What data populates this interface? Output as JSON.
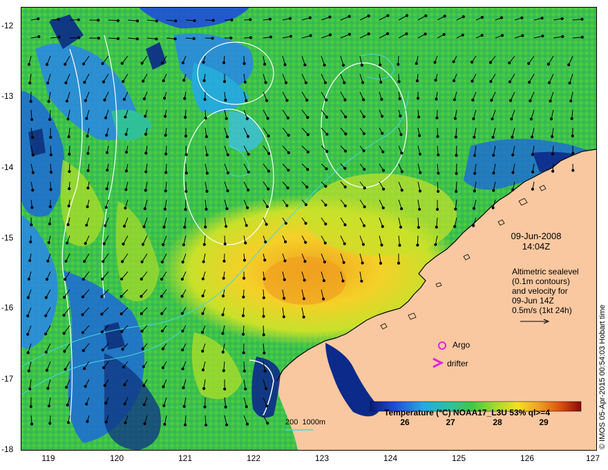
{
  "map": {
    "y_ticks": [
      "-12",
      "-13",
      "-14",
      "-15",
      "-16",
      "-17",
      "-18"
    ],
    "x_ticks": [
      "119",
      "120",
      "121",
      "122",
      "123",
      "124",
      "125",
      "126",
      "127"
    ],
    "lon_range": [
      118.6,
      127.0
    ],
    "lat_range": [
      -18.0,
      -11.8
    ],
    "land_color": "#f9c8a0",
    "sea_colors": [
      "#0b2a8a",
      "#2a8ae0",
      "#3fbfd0",
      "#2fc060",
      "#6cd23a",
      "#c8e12a",
      "#f0c020",
      "#e89018"
    ]
  },
  "info": {
    "date": "09-Jun-2008",
    "time": "14:04Z",
    "altimetry_lines": [
      "Altimetric sealevel",
      "(0.1m contours)",
      "and velocity for",
      "09-Jun 14Z",
      "0.5m/s (1kt 24h)"
    ]
  },
  "legend": {
    "argo_label": "Argo",
    "drifter_label": "drifter",
    "depth_label": "200  1000m"
  },
  "colorbar": {
    "title": "Temperature (°C) NOAA17_L3U 53% ql>=4",
    "ticks": [
      "26",
      "27",
      "28",
      "29"
    ],
    "range": [
      25.1,
      29.8
    ]
  },
  "credit": "© IMOS 05-Apr-2015 00:54:03 Hobart time"
}
